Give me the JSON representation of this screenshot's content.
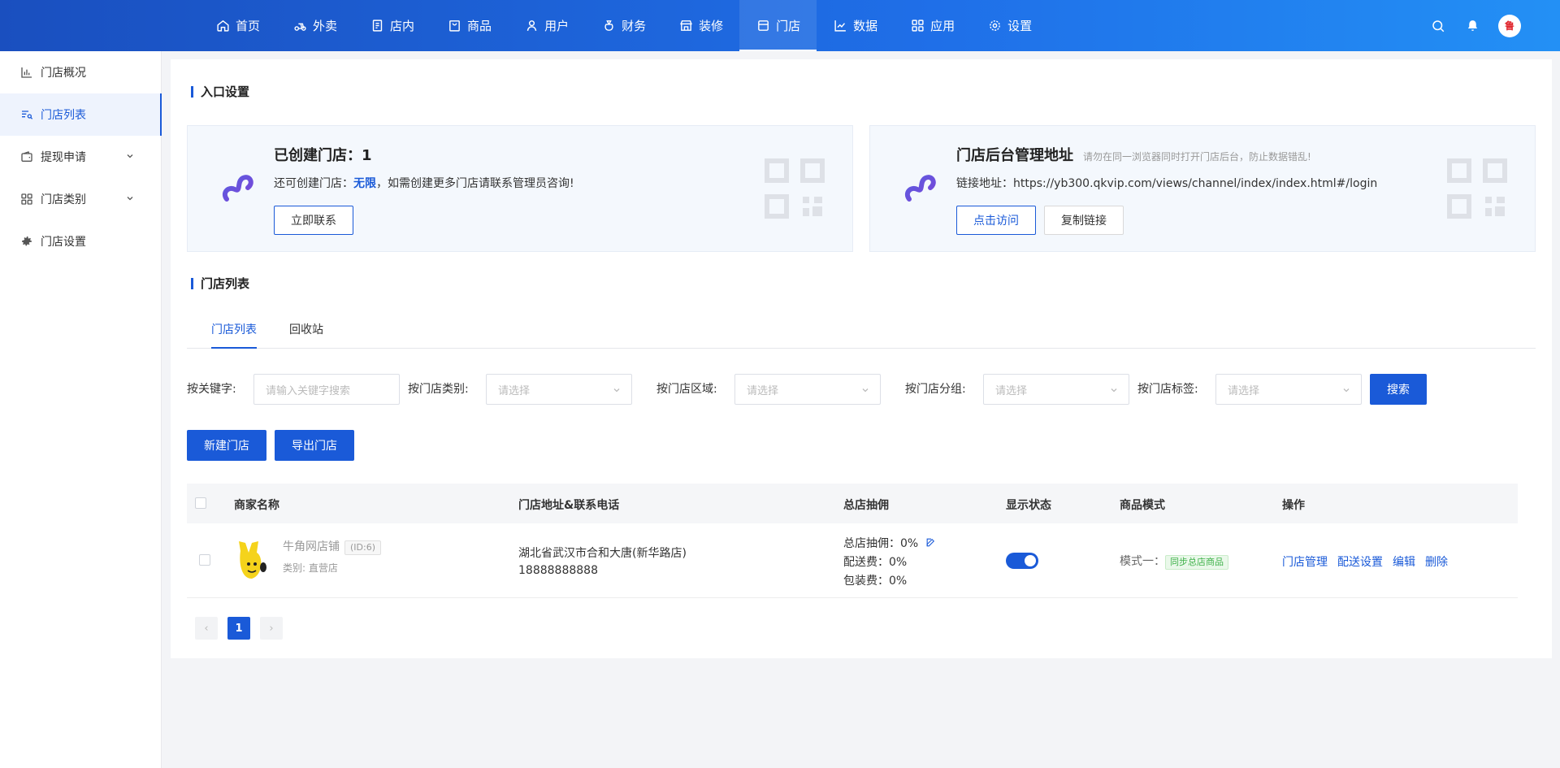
{
  "topnav": {
    "items": [
      {
        "label": "首页",
        "icon": "home-icon"
      },
      {
        "label": "外卖",
        "icon": "scooter-icon"
      },
      {
        "label": "店内",
        "icon": "scan-icon"
      },
      {
        "label": "商品",
        "icon": "bag-icon"
      },
      {
        "label": "用户",
        "icon": "user-icon"
      },
      {
        "label": "财务",
        "icon": "money-bag-icon"
      },
      {
        "label": "装修",
        "icon": "shop-front-icon"
      },
      {
        "label": "门店",
        "icon": "store-icon"
      },
      {
        "label": "数据",
        "icon": "line-chart-icon"
      },
      {
        "label": "应用",
        "icon": "grid-icon"
      },
      {
        "label": "设置",
        "icon": "gear-icon"
      }
    ],
    "active_index": 7,
    "avatar_text": "鲁"
  },
  "sidebar": {
    "items": [
      {
        "label": "门店概况",
        "icon": "bar-chart-icon"
      },
      {
        "label": "门店列表",
        "icon": "list-search-icon"
      },
      {
        "label": "提现申请",
        "icon": "wallet-icon"
      },
      {
        "label": "门店类别",
        "icon": "category-icon"
      },
      {
        "label": "门店设置",
        "icon": "gear-icon"
      }
    ],
    "active_index": 1
  },
  "entry": {
    "title": "入口设置",
    "created_card": {
      "title": "已创建门店：1",
      "line_prefix": "还可创建门店：",
      "line_highlight": "无限",
      "line_suffix": "，如需创建更多门店请联系管理员咨询!",
      "button": "立即联系"
    },
    "admin_card": {
      "title": "门店后台管理地址",
      "hint": "请勿在同一浏览器同时打开门店后台，防止数据错乱!",
      "link_prefix": "链接地址：",
      "link_url": "https://yb300.qkvip.com/views/channel/index/index.html#/login",
      "visit_button": "点击访问",
      "copy_button": "复制链接"
    }
  },
  "store_list": {
    "title": "门店列表",
    "tabs": [
      "门店列表",
      "回收站"
    ],
    "active_tab": 0
  },
  "filters": {
    "keyword_label": "按关键字:",
    "keyword_placeholder": "请输入关键字搜索",
    "category_label": "按门店类别:",
    "region_label": "按门店区域:",
    "group_label": "按门店分组:",
    "tag_label": "按门店标签:",
    "select_placeholder": "请选择",
    "search_button": "搜索"
  },
  "actions": {
    "new_store": "新建门店",
    "export_store": "导出门店"
  },
  "table": {
    "columns": [
      "商家名称",
      "门店地址&联系电话",
      "总店抽佣",
      "显示状态",
      "商品模式",
      "操作"
    ],
    "rows": [
      {
        "name": "牛角网店铺",
        "id_tag": "(ID:6)",
        "category": "类别:  直营店",
        "address": "湖北省武汉市合和大唐(新华路店)",
        "phone": "18888888888",
        "commission": "总店抽佣：0%",
        "delivery_fee": "配送费：0%",
        "packing_fee": "包装费：0%",
        "status_on": true,
        "mode_label": "模式一：",
        "mode_tag": "同步总店商品",
        "ops": [
          "门店管理",
          "配送设置",
          "编辑",
          "删除"
        ]
      }
    ]
  },
  "pagination": {
    "prev": "‹",
    "current": "1",
    "next": "›"
  },
  "colors": {
    "primary": "#1a5ad8",
    "topbar_start": "#1a4fbf",
    "topbar_end": "#2390f5",
    "success": "#3fb24a"
  }
}
